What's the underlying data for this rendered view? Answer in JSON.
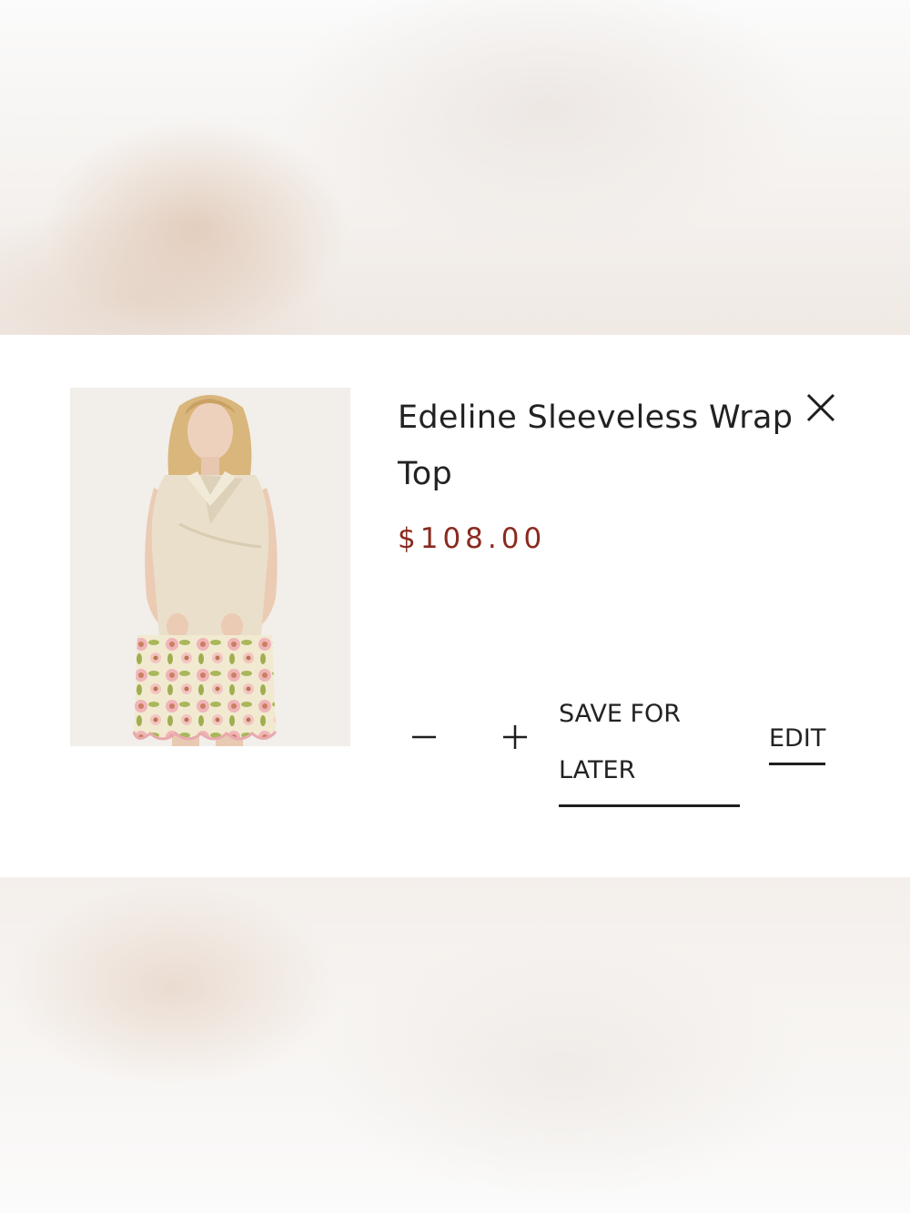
{
  "cart_item": {
    "title": "Edeline Sleeveless Wrap Top",
    "price": "$108.00",
    "image_alt": "model wearing cream sleeveless wrap top and floral scalloped skirt"
  },
  "actions": {
    "save_for_later_label": "SAVE FOR LATER",
    "edit_label": "EDIT"
  },
  "icons": {
    "close": "close-icon",
    "decrease": "minus-icon",
    "increase": "plus-icon"
  },
  "colors": {
    "price": "#8a2a1f",
    "text": "#222222",
    "card": "#ffffff"
  }
}
